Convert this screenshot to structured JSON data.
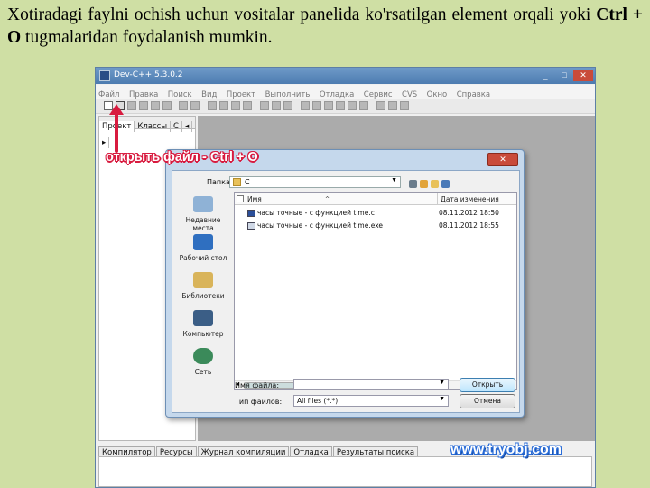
{
  "slide": {
    "text_line1": "Xotiradagi faylni ochish uchun vositalar panelida ko'rsatilgan element orqali yoki ",
    "text_bold": "Ctrl + O",
    "text_line2": " tugmalaridan foydalanish mumkin."
  },
  "ide": {
    "title": "Dev-C++ 5.3.0.2",
    "window_buttons": [
      "_",
      "□",
      "✕"
    ],
    "menu": [
      "Файл",
      "Правка",
      "Поиск",
      "Вид",
      "Проект",
      "Выполнить",
      "Отладка",
      "Сервис",
      "CVS",
      "Окно",
      "Справка"
    ],
    "left_tabs": [
      "Проект",
      "Классы",
      "С",
      "◂",
      "▸"
    ],
    "bottom_tabs": [
      "Компилятор",
      "Ресурсы",
      "Журнал компиляции",
      "Отладка",
      "Результаты поиска"
    ]
  },
  "callout": "открыть файл - Ctrl + O",
  "watermark": "www.tryobj.com",
  "dialog": {
    "close_label": "✕",
    "look_in_label": "Папка:",
    "look_in_value": "C",
    "places": [
      "Недавние места",
      "Рабочий стол",
      "Библиотеки",
      "Компьютер",
      "Сеть"
    ],
    "columns": {
      "name": "Имя",
      "date": "Дата изменения"
    },
    "files": [
      {
        "name": "часы точные - с функцией time.c",
        "date": "08.11.2012 18:50"
      },
      {
        "name": "часы точные - с функцией time.exe",
        "date": "08.11.2012 18:55"
      }
    ],
    "filename_label": "Имя файла:",
    "filename_value": "",
    "filetype_label": "Тип файлов:",
    "filetype_value": "All files (*.*)",
    "open_button": "Открыть",
    "cancel_button": "Отмена"
  },
  "colors": {
    "slide_bg": "#cfdfa4",
    "callout": "#d81b3f",
    "watermark": "#2a6dd8"
  }
}
